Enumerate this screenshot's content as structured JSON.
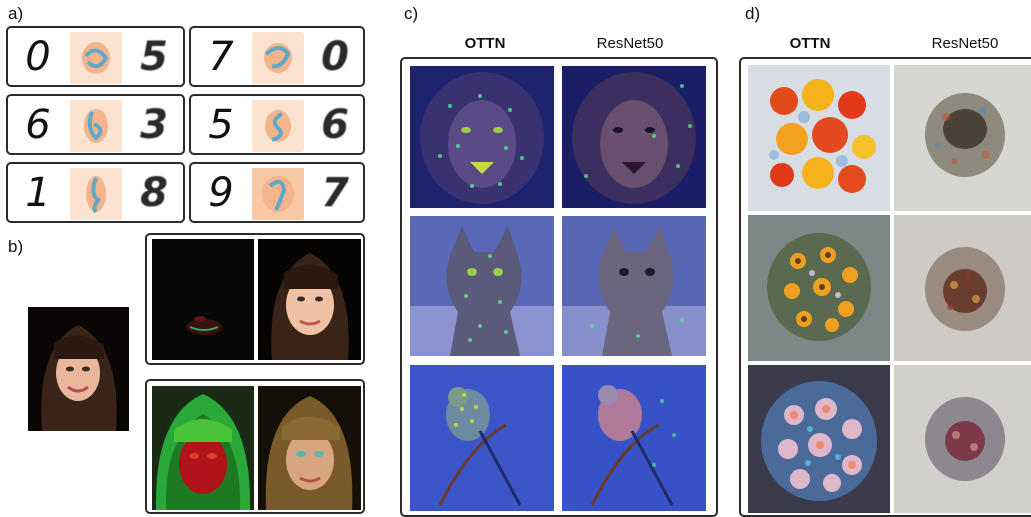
{
  "panels": {
    "a": "a)",
    "b": "b)",
    "c": "c)",
    "d": "d)"
  },
  "panel_a": {
    "rows": [
      {
        "input": "0",
        "result": "5"
      },
      {
        "input": "7",
        "result": "0"
      },
      {
        "input": "6",
        "result": "3"
      },
      {
        "input": "5",
        "result": "6"
      },
      {
        "input": "1",
        "result": "8"
      },
      {
        "input": "9",
        "result": "7"
      }
    ]
  },
  "panel_c": {
    "col1": "OTTN",
    "col2": "ResNet50"
  },
  "panel_d": {
    "col1": "OTTN",
    "col2": "ResNet50"
  },
  "colors": {
    "border": "#2b2b2b",
    "heat_orange": "#f4b48c",
    "heat_blue": "#5fa8c8",
    "overlay_blue": "#3b4bb8"
  }
}
